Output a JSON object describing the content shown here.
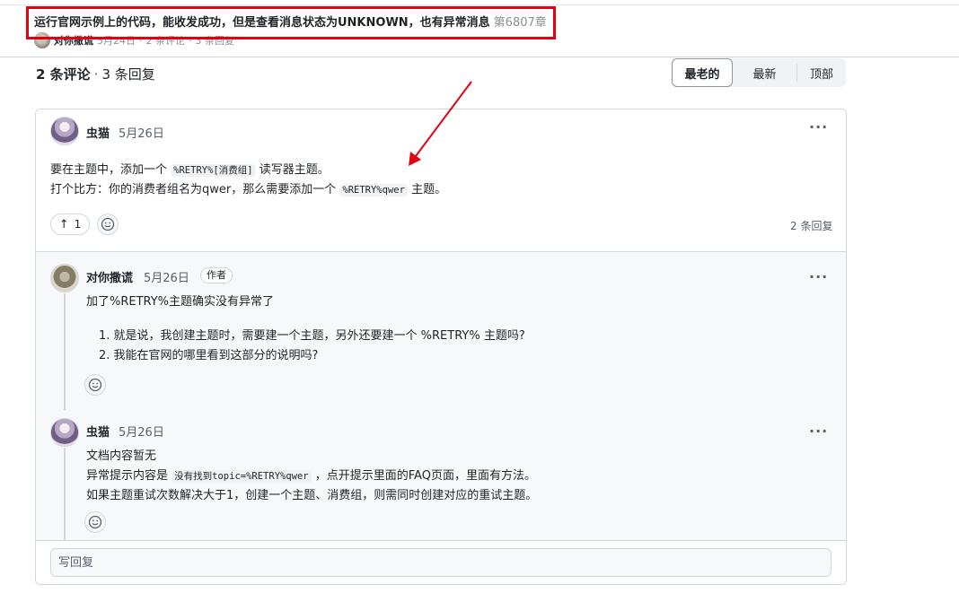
{
  "header": {
    "title": "运行官网示例上的代码，能收发成功，但是查看消息状态为UNKNOWN，也有异常消息",
    "number": "第680",
    "number_trail": "7章",
    "author": "对你撒谎",
    "date": "5月24日",
    "comments": "2 条评论",
    "replies": "3 条回复",
    "dot": "·"
  },
  "comments_header": {
    "count": "2 条评论",
    "dot": "·",
    "replies": "3 条回复"
  },
  "sort": {
    "oldest": "最老的",
    "newest": "最新",
    "top": "顶部"
  },
  "main_comment": {
    "author": "虫猫",
    "date": "5月26日",
    "more": "···",
    "line1_pre": "要在主题中，添加一个",
    "line1_code": "%RETRY%[消费组]",
    "line1_post": "读写器主题。",
    "line2_pre": "打个比方：你的消费者组名为qwer，那么需要添加一个",
    "line2_code": "%RETRY%qwer",
    "line2_post": "主题。",
    "upvote_arrow": "↑",
    "upvotes": "1",
    "reply_count": "2 条回复"
  },
  "reply1": {
    "author": "对你撒谎",
    "date": "5月26日",
    "badge": "作者",
    "more": "···",
    "text": "加了%RETRY%主题确实没有异常了",
    "list": [
      "1. 就是说，我创建主题时，需要建一个主题，另外还要建一个 %RETRY% 主题吗?",
      "2. 我能在官网的哪里看到这部分的说明吗?"
    ]
  },
  "reply2": {
    "author": "虫猫",
    "date": "5月26日",
    "more": "···",
    "line1": "文档内容暂无",
    "line2_pre": "异常提示内容是",
    "line2_code": "没有找到topic=%RETRY%qwer",
    "line2_post": "，点开提示里面的FAQ页面，里面有方法。",
    "line3": "如果主题重试次数解决大于1，创建一个主题、消费组，则需同时创建对应的重试主题。"
  },
  "reply_box": {
    "placeholder": "写回复"
  },
  "colors": {
    "annotation_red": "#e30012",
    "border": "#d0d7de",
    "muted": "#57606a"
  }
}
